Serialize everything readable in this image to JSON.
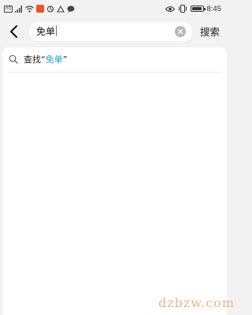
{
  "status_bar": {
    "time": "8:45",
    "hd_label": "HD",
    "icons": [
      "hd-icon",
      "signal-icon",
      "wifi-icon",
      "app-notification-icon",
      "app-icon",
      "app-icon",
      "chat-icon",
      "eye-icon",
      "vibrate-icon",
      "battery-icon"
    ]
  },
  "search": {
    "query_text": "免单",
    "submit_label": "搜索"
  },
  "suggestion": {
    "prefix": "查找“",
    "keyword": "免单",
    "suffix": "”"
  },
  "watermark": "dzbzw.com",
  "colors": {
    "highlight": "#1aa1c8",
    "cursor": "#2d7bf6",
    "watermark": "#f0b58a"
  }
}
